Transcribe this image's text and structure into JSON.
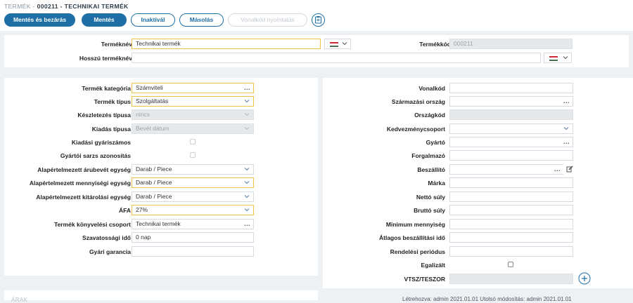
{
  "header": {
    "prefix": "TERMÉK - ",
    "code_title": "000211 - TECHNIKAI TERMÉK"
  },
  "toolbar": {
    "save_close": "Mentés és bezárás",
    "save": "Mentés",
    "inactivate": "Inaktivál",
    "copy": "Másolás",
    "barcode_print": "Vonalkód nyomtatás"
  },
  "top_form": {
    "name_label": "Terméknév",
    "name_value": "Technikai termék",
    "long_name_label": "Hosszú terméknév",
    "long_name_value": "",
    "code_label": "Termékkód",
    "code_value": "000211"
  },
  "left_form": {
    "category_label": "Termék kategória",
    "category_value": "Számviteli",
    "type_label": "Termék típus",
    "type_value": "Szolgáltatás",
    "stock_type_label": "Készletezés típusa",
    "stock_type_value": "nincs",
    "issue_type_label": "Kiadás típusa",
    "issue_type_value": "Bevét dátum",
    "issue_serial_label": "Kiadási gyáriszámos",
    "batch_id_label": "Gyártói sarzs azonosítás",
    "default_receipt_unit_label": "Alapértelmezett árubevét egység",
    "default_receipt_unit_value": "Darab / Piece",
    "default_qty_unit_label": "Alapértelmezett mennyiségi egység",
    "default_qty_unit_value": "Darab / Piece",
    "default_issue_unit_label": "Alapértelmezett kitárolási egység",
    "default_issue_unit_value": "Darab / Piece",
    "vat_label": "ÁFA",
    "vat_value": "27%",
    "accounting_group_label": "Termék könyvelési csoport",
    "accounting_group_value": "Technikai termék",
    "shelf_life_label": "Szavatossági idő",
    "shelf_life_value": "0 nap",
    "warranty_label": "Gyári garancia",
    "warranty_value": ""
  },
  "right_form": {
    "barcode_label": "Vonalkód",
    "origin_country_label": "Származási ország",
    "country_code_label": "Országkód",
    "discount_group_label": "Kedvezménycsoport",
    "manufacturer_label": "Gyártó",
    "distributor_label": "Forgalmazó",
    "supplier_label": "Beszállító",
    "brand_label": "Márka",
    "net_weight_label": "Nettó súly",
    "gross_weight_label": "Bruttó súly",
    "min_qty_label": "Minimum mennyiség",
    "avg_lead_time_label": "Átlagos beszállítási idő",
    "order_period_label": "Rendelési periódus",
    "settled_label": "Egalizált",
    "vtsz_label": "VTSZ/TESZOR"
  },
  "footer": {
    "section_label": "ÁRAK",
    "meta_text": "Létrehozva: admin 2021.01.01      Utolsó módosítás: admin 2021.01.01"
  },
  "colors": {
    "accent": "#1d6fa5",
    "required_border": "#f0c24a",
    "disabled_bg": "#e6e9ec"
  },
  "icons": {
    "dropdown": "chevron-down-icon",
    "lookup": "ellipsis-icon",
    "flag": "hungary-flag-icon",
    "edit": "pencil-icon",
    "add": "plus-circle-icon",
    "barcode_toolbar": "barcode-printer-icon"
  }
}
